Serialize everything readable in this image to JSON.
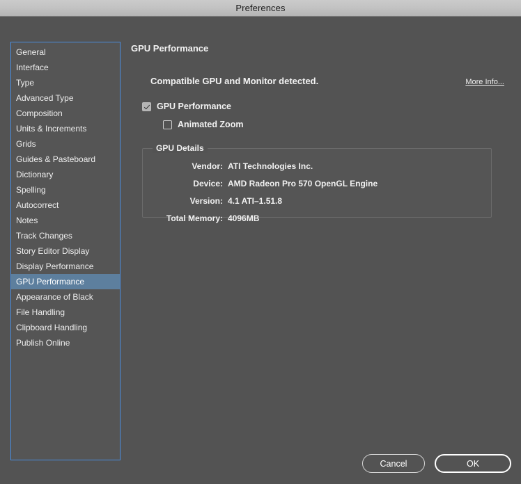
{
  "window": {
    "title": "Preferences"
  },
  "sidebar": {
    "items": [
      {
        "label": "General",
        "selected": false
      },
      {
        "label": "Interface",
        "selected": false
      },
      {
        "label": "Type",
        "selected": false
      },
      {
        "label": "Advanced Type",
        "selected": false
      },
      {
        "label": "Composition",
        "selected": false
      },
      {
        "label": "Units & Increments",
        "selected": false
      },
      {
        "label": "Grids",
        "selected": false
      },
      {
        "label": "Guides & Pasteboard",
        "selected": false
      },
      {
        "label": "Dictionary",
        "selected": false
      },
      {
        "label": "Spelling",
        "selected": false
      },
      {
        "label": "Autocorrect",
        "selected": false
      },
      {
        "label": "Notes",
        "selected": false
      },
      {
        "label": "Track Changes",
        "selected": false
      },
      {
        "label": "Story Editor Display",
        "selected": false
      },
      {
        "label": "Display Performance",
        "selected": false
      },
      {
        "label": "GPU Performance",
        "selected": true
      },
      {
        "label": "Appearance of Black",
        "selected": false
      },
      {
        "label": "File Handling",
        "selected": false
      },
      {
        "label": "Clipboard Handling",
        "selected": false
      },
      {
        "label": "Publish Online",
        "selected": false
      }
    ]
  },
  "panel": {
    "title": "GPU Performance",
    "status_text": "Compatible GPU and Monitor detected.",
    "more_info_label": "More Info...",
    "checkboxes": [
      {
        "label": "GPU Performance",
        "checked": true
      },
      {
        "label": "Animated Zoom",
        "checked": false
      }
    ],
    "group": {
      "legend": "GPU Details",
      "rows": [
        {
          "label": "Vendor:",
          "value": "ATI Technologies Inc."
        },
        {
          "label": "Device:",
          "value": "AMD Radeon Pro 570 OpenGL Engine"
        },
        {
          "label": "Version:",
          "value": "4.1 ATI–1.51.8"
        },
        {
          "label": "Total Memory:",
          "value": "4096MB"
        }
      ]
    }
  },
  "footer": {
    "cancel_label": "Cancel",
    "ok_label": "OK"
  },
  "colors": {
    "dialog_bg": "#535353",
    "titlebar_bg": "#c2c2c2",
    "selection": "#5d7f9e",
    "focus_ring": "#4a8ee0",
    "text": "#f2f2f2"
  }
}
